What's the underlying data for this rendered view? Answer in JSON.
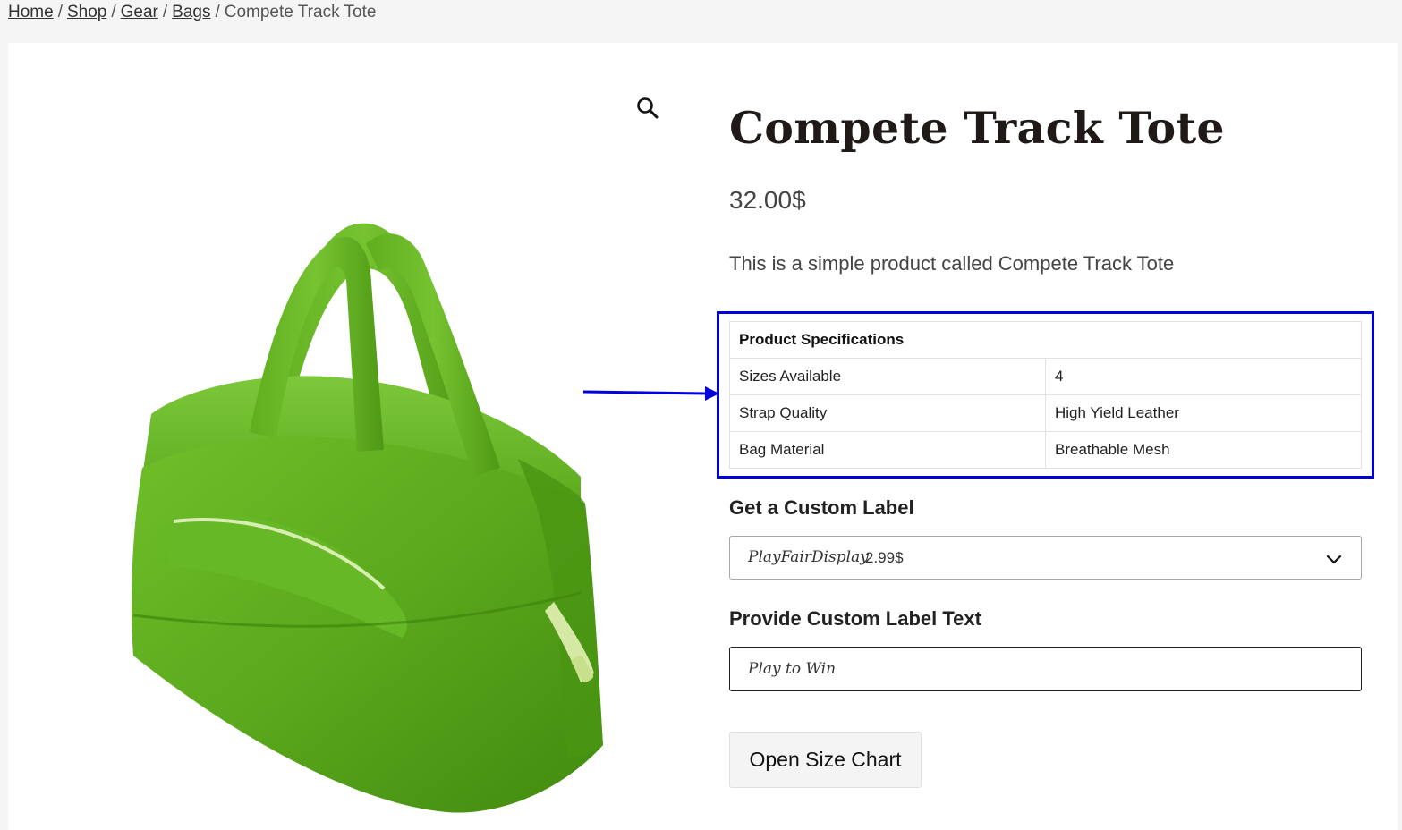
{
  "breadcrumb": {
    "items": [
      {
        "label": "Home"
      },
      {
        "label": "Shop"
      },
      {
        "label": "Gear"
      },
      {
        "label": "Bags"
      }
    ],
    "current": "Compete Track Tote",
    "separator": "/"
  },
  "product": {
    "title": "Compete Track Tote",
    "price": "32.00$",
    "description": "This is a simple product called Compete Track Tote",
    "image_icon": "green-tote-bag",
    "zoom_icon": "search-icon"
  },
  "specifications": {
    "heading": "Product Specifications",
    "rows": [
      {
        "label": "Sizes Available",
        "value": "4"
      },
      {
        "label": "Strap Quality",
        "value": "High Yield Leather"
      },
      {
        "label": "Bag Material",
        "value": "Breathable Mesh"
      }
    ]
  },
  "annotation": {
    "highlight_color": "#0000dd"
  },
  "custom_label": {
    "heading": "Get a Custom Label",
    "selected_font": "PlayFairDisplay",
    "selected_price": "2.99$"
  },
  "custom_text": {
    "heading": "Provide Custom Label Text",
    "value": "Play to Win"
  },
  "size_chart": {
    "button_label": "Open Size Chart"
  }
}
